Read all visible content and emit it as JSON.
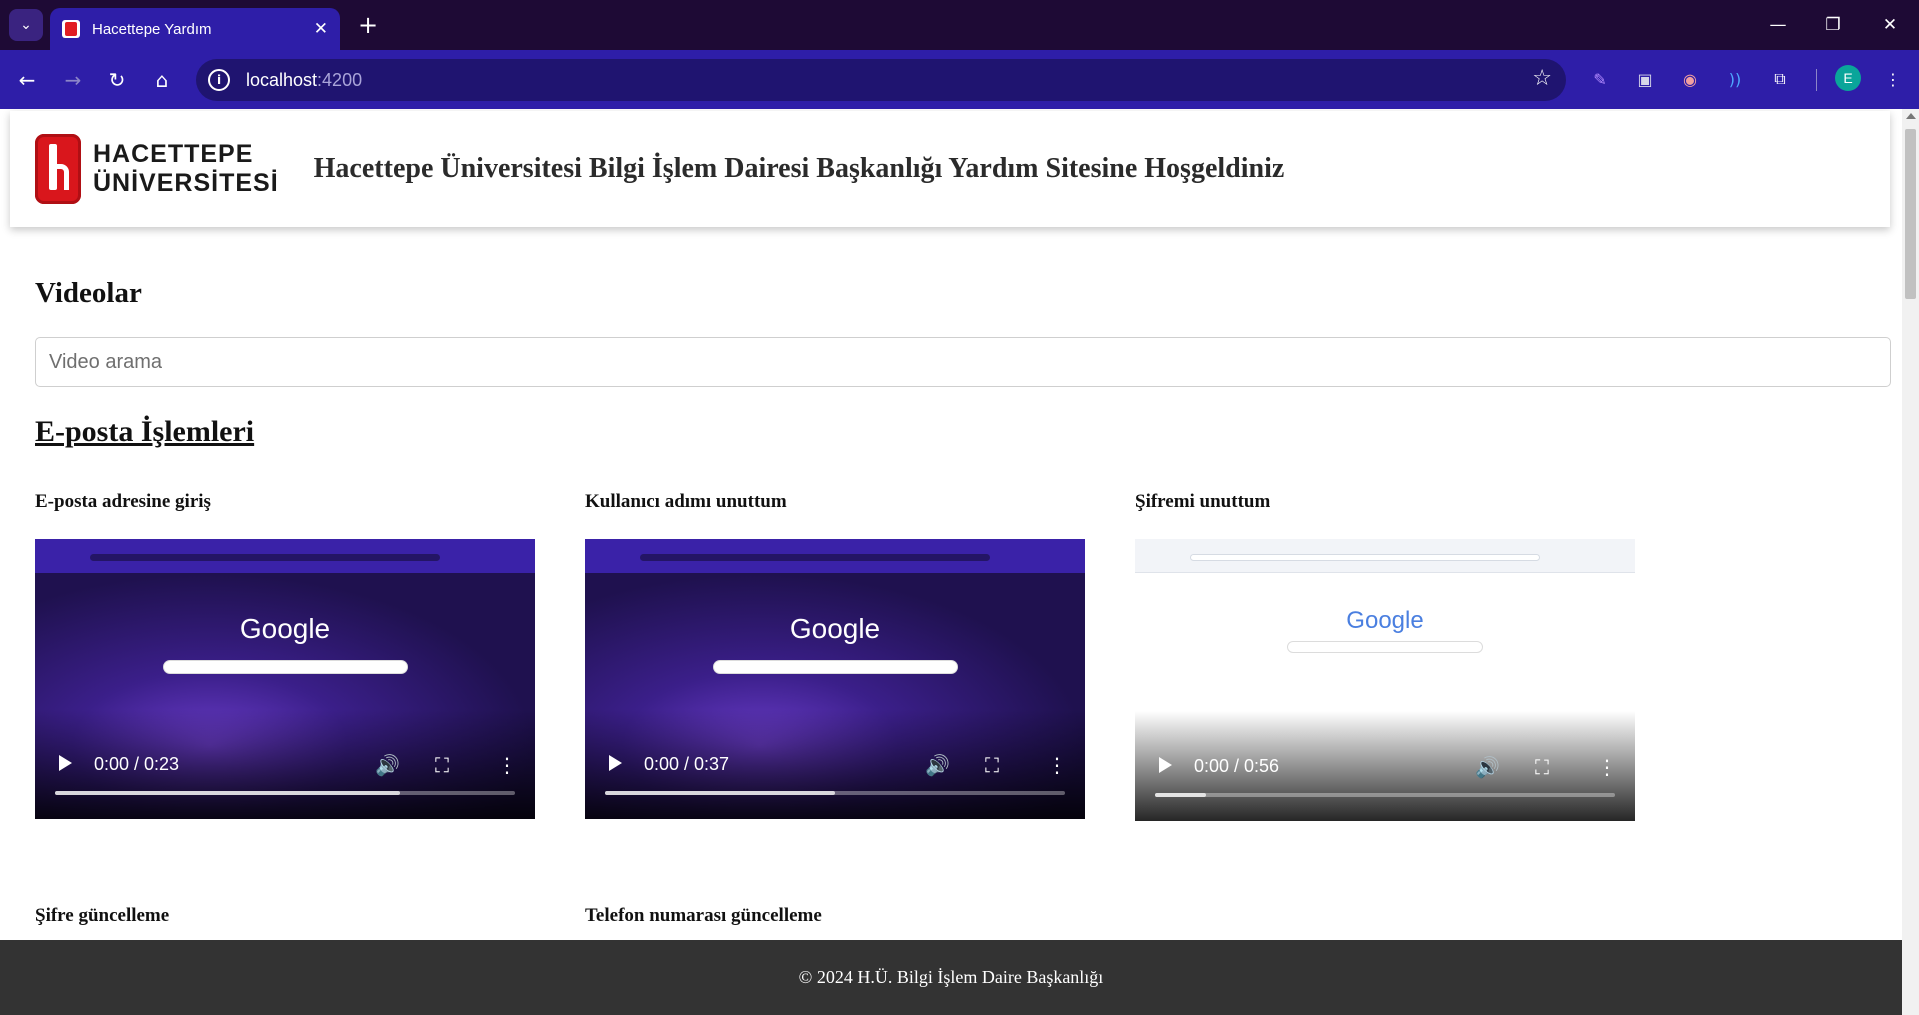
{
  "browser": {
    "tab_title": "Hacettepe Yardım",
    "url_host": "localhost",
    "url_port": ":4200",
    "profile_initial": "E",
    "accent": "#2e1ea8"
  },
  "header": {
    "logo_line1": "HACETTEPE",
    "logo_line2": "ÜNİVERSİTESİ",
    "title": "Hacettepe Üniversitesi Bilgi İşlem Dairesi Başkanlığı Yardım Sitesine Hoşgeldiniz"
  },
  "videos_section": {
    "title": "Videolar",
    "search_placeholder": "Video arama",
    "category": "E-posta İşlemleri",
    "items": [
      {
        "label": "E-posta adresine giriş",
        "time": "0:00 / 0:23",
        "progress": 0.75,
        "theme": "dark",
        "logo": "Google"
      },
      {
        "label": "Kullanıcı adımı unuttum",
        "time": "0:00 / 0:37",
        "progress": 0.5,
        "theme": "dark",
        "logo": "Google"
      },
      {
        "label": "Şifremi unuttum",
        "time": "0:00 / 0:56",
        "progress": 0.11,
        "theme": "light",
        "logo": "Google"
      },
      {
        "label": "Şifre güncelleme"
      },
      {
        "label": "Telefon numarası güncelleme"
      }
    ]
  },
  "footer": {
    "text": "© 2024 H.Ü. Bilgi İşlem Daire Başkanlığı"
  }
}
